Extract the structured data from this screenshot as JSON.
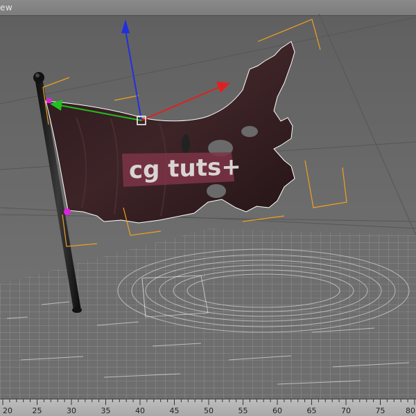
{
  "viewport": {
    "label": "ew",
    "colors": {
      "background_top": "#5f5f5f",
      "background_bottom": "#7b7b7b",
      "flag_cloth": "#3a2326",
      "flag_banner": "#8a3a50",
      "pole": "#1a1a1a",
      "selection_brackets": "#f0a020",
      "axis_x": "#e02020",
      "axis_y": "#20c020",
      "axis_z": "#2030e0",
      "vertex_pin": "#e020e0"
    },
    "logo_text": "cg tuts+",
    "icons": [
      "move-gizmo-icon",
      "pivot-icon",
      "pin-vertex-icon"
    ]
  },
  "timeline": {
    "ticks": [
      "20",
      "25",
      "30",
      "35",
      "40",
      "45",
      "50",
      "55",
      "60",
      "65",
      "70",
      "75",
      "80"
    ]
  }
}
